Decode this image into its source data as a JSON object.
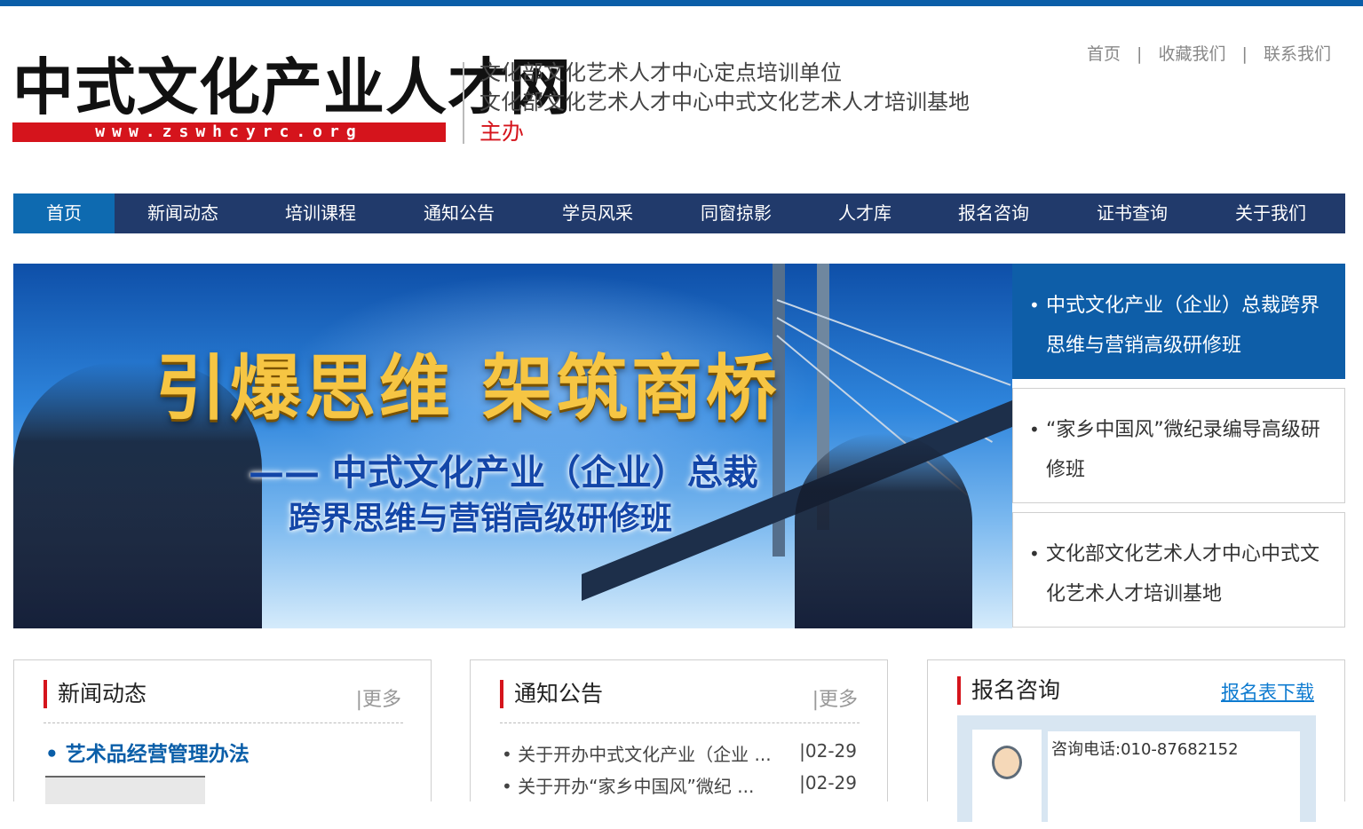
{
  "site": {
    "logo_title": "中式文化产业人才网",
    "logo_url": "www.zswhcyrc.org",
    "org_line1": "文化部文化艺术人才中心定点培训单位",
    "org_line2": "文化部文化艺术人才中心中式文化艺术人才培训基地",
    "org_host": "主办"
  },
  "toplinks": {
    "home": "首页",
    "favorite": "收藏我们",
    "contact": "联系我们",
    "separator": "|"
  },
  "nav": [
    {
      "label": "首页",
      "active": true
    },
    {
      "label": "新闻动态"
    },
    {
      "label": "培训课程"
    },
    {
      "label": "通知公告"
    },
    {
      "label": "学员风采"
    },
    {
      "label": "同窗掠影"
    },
    {
      "label": "人才库"
    },
    {
      "label": "报名咨询"
    },
    {
      "label": "证书查询"
    },
    {
      "label": "关于我们"
    }
  ],
  "banner": {
    "title": "引爆思维  架筑商桥",
    "subtitle1": "—— 中式文化产业（企业）总裁",
    "subtitle2": "跨界思维与营销高级研修班"
  },
  "banner_list": [
    {
      "text": "中式文化产业（企业）总裁跨界思维与营销高级研修班",
      "active": true
    },
    {
      "text": "“家乡中国风”微纪录编导高级研修班"
    },
    {
      "text": "文化部文化艺术人才中心中式文化艺术人才培训基地"
    }
  ],
  "news": {
    "title": "新闻动态",
    "more": "|更多",
    "first_item": "艺术品经营管理办法"
  },
  "notices": {
    "title": "通知公告",
    "more": "|更多",
    "items": [
      {
        "title": "关于开办中式文化产业（企业 ...",
        "date": "|02-29"
      },
      {
        "title": "关于开办“家乡中国风”微纪 ...",
        "date": "|02-29"
      }
    ]
  },
  "registration": {
    "title": "报名咨询",
    "download": "报名表下载",
    "phone": "咨询电话:010-87682152"
  },
  "colors": {
    "topbar": "#0a5ea8",
    "nav_bg": "#213a6b",
    "nav_active": "#0e6ab0",
    "brand_red": "#d5141c",
    "link_blue": "#0e7bd0"
  }
}
